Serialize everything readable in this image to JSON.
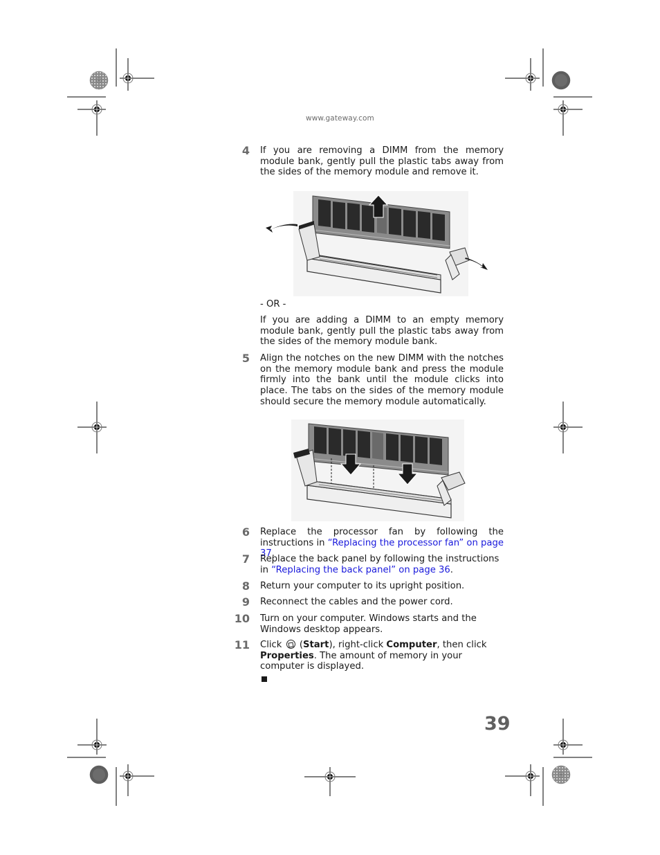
{
  "header": {
    "url": "www.gateway.com"
  },
  "steps": [
    {
      "number": "4",
      "text": "If you are removing a DIMM from the memory module bank, gently pull the plastic tabs away from the sides of the memory module and remove it."
    },
    {
      "separator": "- OR -",
      "text": "If you are adding a DIMM to an empty memory module bank, gently pull the plastic tabs away from the sides of the memory module bank."
    },
    {
      "number": "5",
      "text": "Align the notches on the new DIMM with the notches on the memory module bank and press the module firmly into the bank until the module clicks into place. The tabs on the sides of the memory module should secure the memory module automatically."
    },
    {
      "number": "6",
      "text_before": "Replace the processor fan by following the instructions in ",
      "link": "“Replacing the processor fan” on page 37",
      "text_after": "."
    },
    {
      "number": "7",
      "text_before": "Replace the back panel by following the instructions in ",
      "link": "“Replacing the back panel” on page 36",
      "text_after": "."
    },
    {
      "number": "8",
      "text": "Return your computer to its upright position."
    },
    {
      "number": "9",
      "text": "Reconnect the cables and the power cord."
    },
    {
      "number": "10",
      "text": "Turn on your computer. Windows starts and the Windows desktop appears."
    },
    {
      "number": "11",
      "parts": {
        "click": "Click ",
        "icon": "windows-start-icon",
        "open_paren": " (",
        "start": "Start",
        "close_paren_text": "), right-click ",
        "computer": "Computer",
        "then_click": ", then click ",
        "properties": "Properties",
        "rest": ". The amount of memory in your computer is displayed."
      }
    }
  ],
  "figures": {
    "remove_dimm": {
      "description": "DIMM being removed from memory module bank with tabs pulled outward",
      "arrows": [
        "left-tab-out",
        "module-up",
        "right-tab-out"
      ]
    },
    "insert_dimm": {
      "description": "DIMM being aligned with notches and pressed into memory module bank",
      "arrows": [
        "module-down-left",
        "module-down-right"
      ]
    }
  },
  "footer": {
    "page_number": "39"
  },
  "colors": {
    "link": "#1a1adc",
    "step_number": "#6a6a6a",
    "text": "#1a1a1a"
  }
}
